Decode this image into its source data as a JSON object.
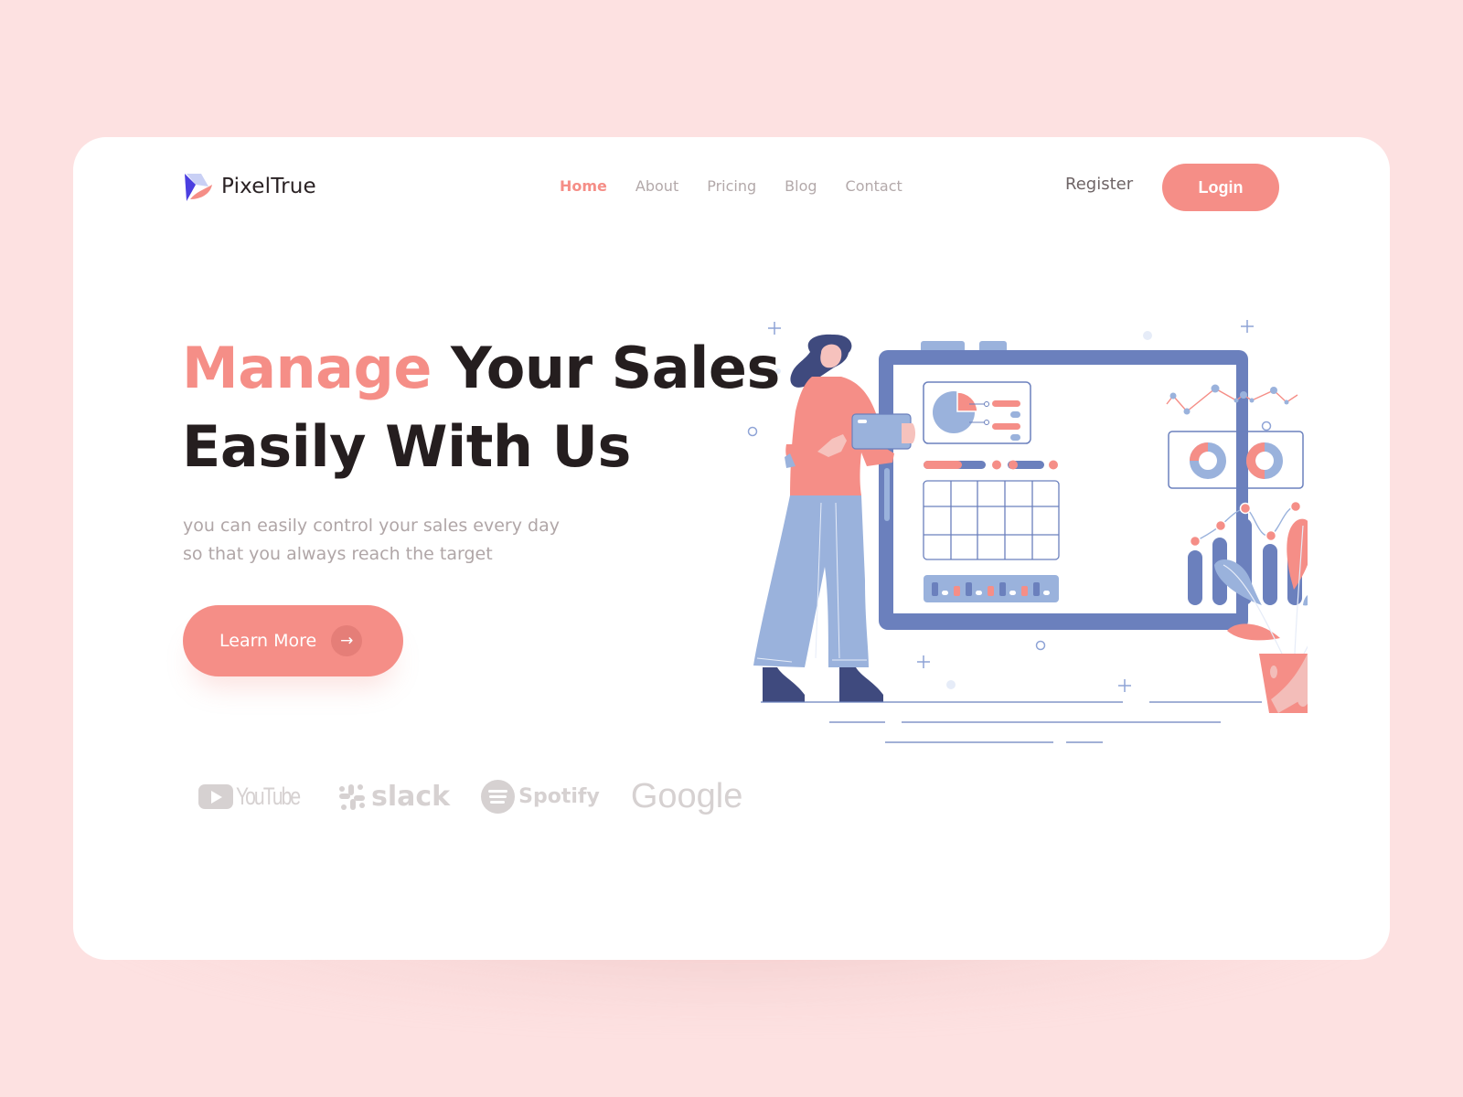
{
  "brand": {
    "name": "PixelTrue",
    "logo_icon": "pixeltrue-logo-icon"
  },
  "nav": {
    "items": [
      {
        "label": "Home",
        "active": true
      },
      {
        "label": "About",
        "active": false
      },
      {
        "label": "Pricing",
        "active": false
      },
      {
        "label": "Blog",
        "active": false
      },
      {
        "label": "Contact",
        "active": false
      }
    ],
    "register_label": "Register",
    "login_label": "Login"
  },
  "hero": {
    "headline_accent": "Manage",
    "headline_rest_line1": "Your Sales",
    "headline_line2": "Easily With Us",
    "subtext_line1": "you can easily control your sales every day",
    "subtext_line2": "so that you always reach the target",
    "cta_label": "Learn More",
    "cta_icon": "arrow-right-icon"
  },
  "partners": [
    {
      "name": "YouTube",
      "icon": "youtube-icon"
    },
    {
      "name": "slack",
      "icon": "slack-icon"
    },
    {
      "name": "Spotify",
      "icon": "spotify-icon"
    },
    {
      "name": "Google",
      "icon": "google-wordmark"
    }
  ],
  "colors": {
    "page_bg": "#fde1e1",
    "card_bg": "#ffffff",
    "accent": "#f58e87",
    "heading": "#251e1f",
    "muted_text": "#b0a6a7",
    "nav_text": "#b3a9aa",
    "illustration_blue": "#6b80bd",
    "illustration_light_blue": "#9ab2dc",
    "illustration_navy": "#3f4a7e",
    "brand_logos": "#d6d1d1"
  },
  "illustration": {
    "description": "woman-with-tablet-presenting-sales-dashboard",
    "dashboard_widgets": [
      "pie-chart-card",
      "line-chart",
      "donut-charts-card",
      "progress-bars",
      "calendar-grid",
      "bar-timeline",
      "bar-line-combo-chart"
    ]
  }
}
